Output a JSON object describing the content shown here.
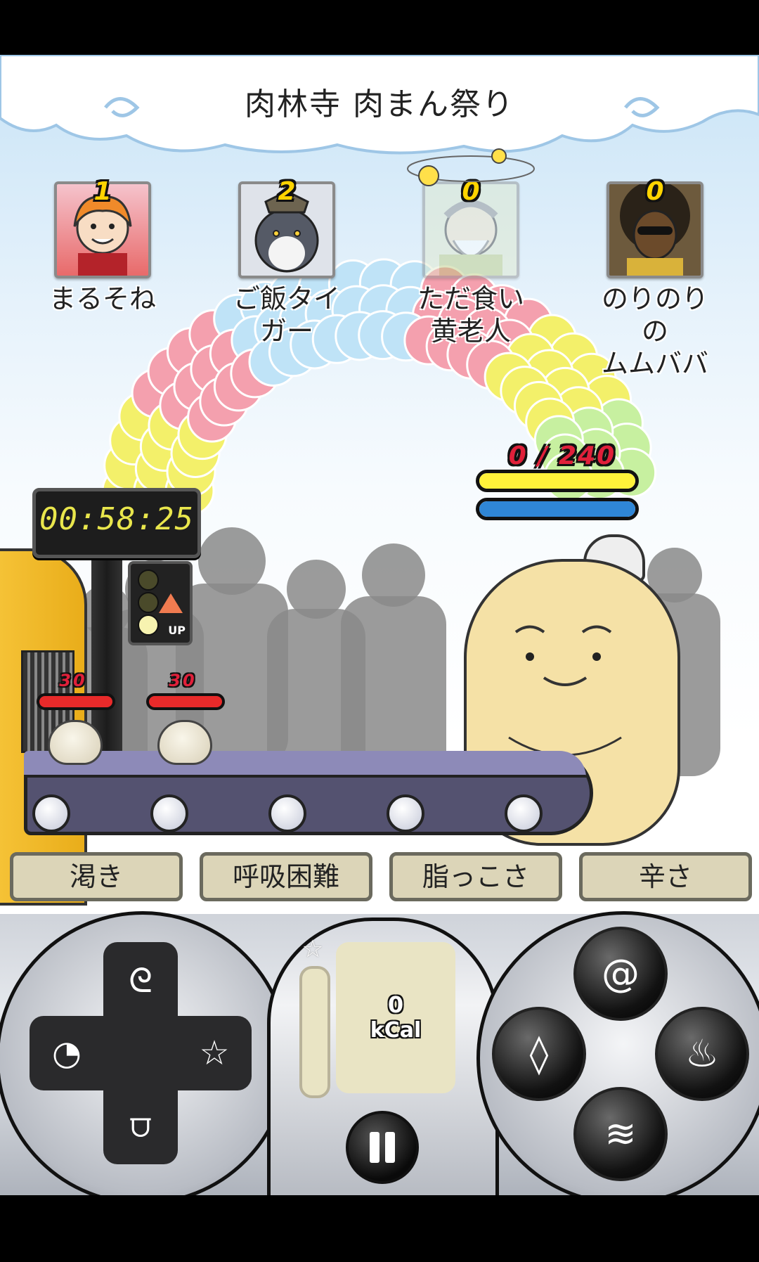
{
  "stage": {
    "title": "肉林寺 肉まん祭り"
  },
  "competitors": [
    {
      "rank": "1",
      "name_line1": "まるそね",
      "name_line2": "",
      "faded": false
    },
    {
      "rank": "2",
      "name_line1": "ご飯タイガー",
      "name_line2": "",
      "faded": false
    },
    {
      "rank": "0",
      "name_line1": "ただ食い",
      "name_line2": "黄老人",
      "faded": true
    },
    {
      "rank": "0",
      "name_line1": "のりのりの",
      "name_line2": "ムムババ",
      "faded": false
    }
  ],
  "timer": {
    "value": "00:58:25"
  },
  "signal": {
    "up_label": "UP"
  },
  "player": {
    "score": "0 / 240",
    "yellow_bar_fraction": 1.0,
    "blue_bar_fraction": 1.0
  },
  "buns": [
    {
      "hp": "30",
      "hp_fraction": 1.0
    },
    {
      "hp": "30",
      "hp_fraction": 1.0
    }
  ],
  "status_buttons": [
    {
      "label": "渇き"
    },
    {
      "label": "呼吸困難"
    },
    {
      "label": "脂っこさ"
    },
    {
      "label": "辛さ"
    }
  ],
  "controls": {
    "kcal_value": "0",
    "kcal_unit": "kCal",
    "star_symbol": "☆",
    "dpad": {
      "up_icon": "swirl-icon",
      "left_icon": "pacman-icon",
      "right_icon": "star-icon",
      "down_icon": "mouthguard-icon"
    },
    "actions": {
      "top_icon": "spiral-icon",
      "left_icon": "drop-icon",
      "right_icon": "flame-icon",
      "bottom_icon": "zigzag-icon"
    }
  },
  "colors": {
    "accent_yellow": "#fff23a",
    "accent_blue": "#2f86d6",
    "hp_red": "#e82a2a",
    "timer_digits": "#e9e64c"
  }
}
